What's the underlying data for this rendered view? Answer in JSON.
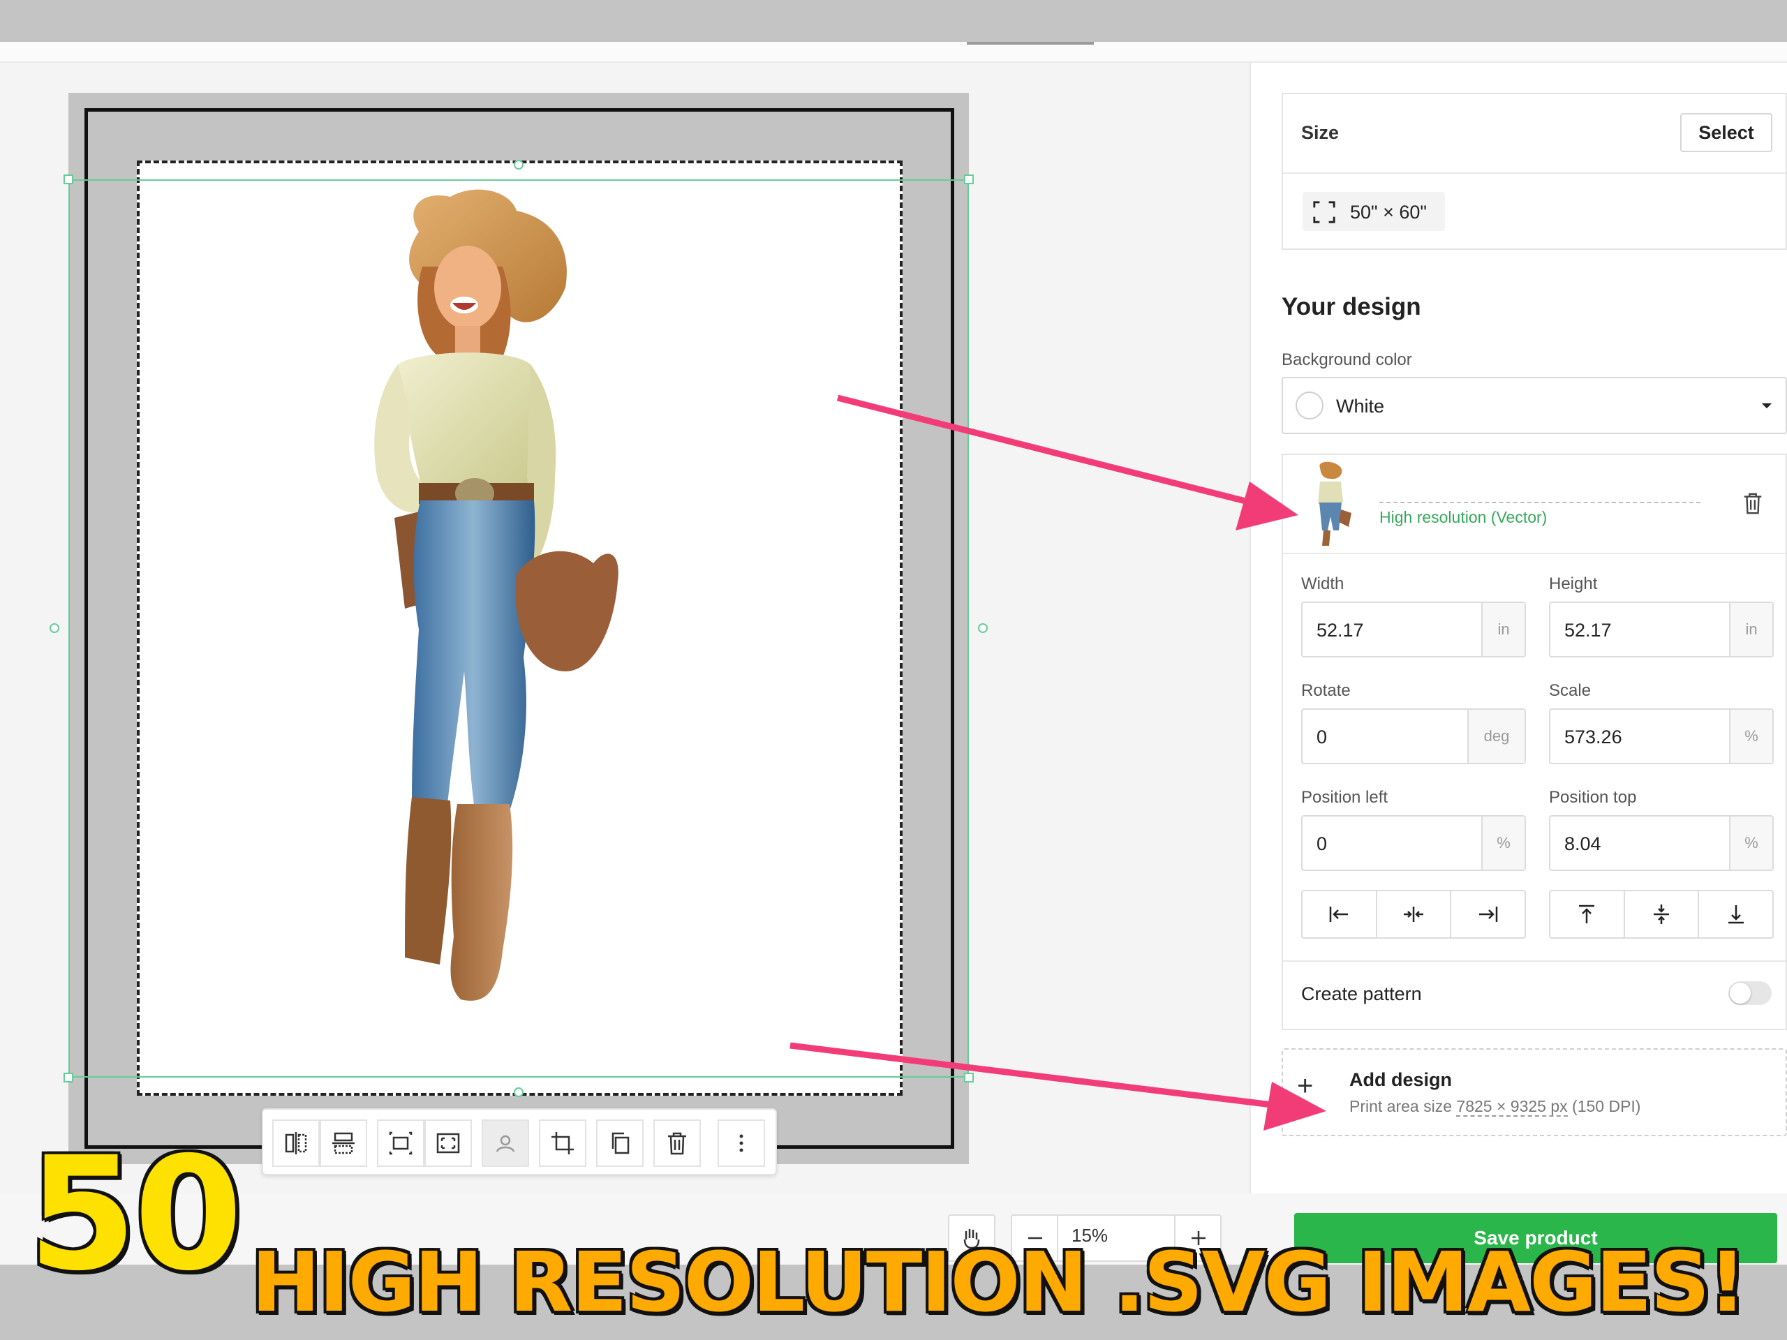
{
  "size_card": {
    "label": "Size",
    "select_label": "Select",
    "value": "50\" × 60\""
  },
  "design": {
    "heading": "Your design",
    "bg_label": "Background color",
    "bg_value": "White",
    "layer_quality": "High resolution (Vector)",
    "width_label": "Width",
    "width_value": "52.17",
    "width_unit": "in",
    "height_label": "Height",
    "height_value": "52.17",
    "height_unit": "in",
    "rotate_label": "Rotate",
    "rotate_value": "0",
    "rotate_unit": "deg",
    "scale_label": "Scale",
    "scale_value": "573.26",
    "scale_unit": "%",
    "pos_left_label": "Position left",
    "pos_left_value": "0",
    "pos_left_unit": "%",
    "pos_top_label": "Position top",
    "pos_top_value": "8.04",
    "pos_top_unit": "%",
    "pattern_label": "Create pattern",
    "add_label": "Add design",
    "print_area_prefix": "Print area size",
    "print_area_size": "7825 × 9325 px",
    "print_area_dpi": "(150 DPI)"
  },
  "zoom": {
    "value": "15%"
  },
  "save_label": "Save product",
  "banner": {
    "number": "50",
    "text": "HIGH RESOLUTION .SVG IMAGES!"
  },
  "colors": {
    "accent_green": "#2bb64b",
    "arrow_pink": "#f23c78",
    "banner_yellow": "#ffe100",
    "banner_orange": "#ffaa00"
  },
  "icons": [
    "flip-horizontal-icon",
    "flip-vertical-icon",
    "fit-icon",
    "fill-icon",
    "remove-background-icon",
    "crop-icon",
    "duplicate-icon",
    "trash-icon",
    "more-icon",
    "fullscreen-icon",
    "hand-icon",
    "minus-icon",
    "plus-icon",
    "chevron-down-icon"
  ]
}
